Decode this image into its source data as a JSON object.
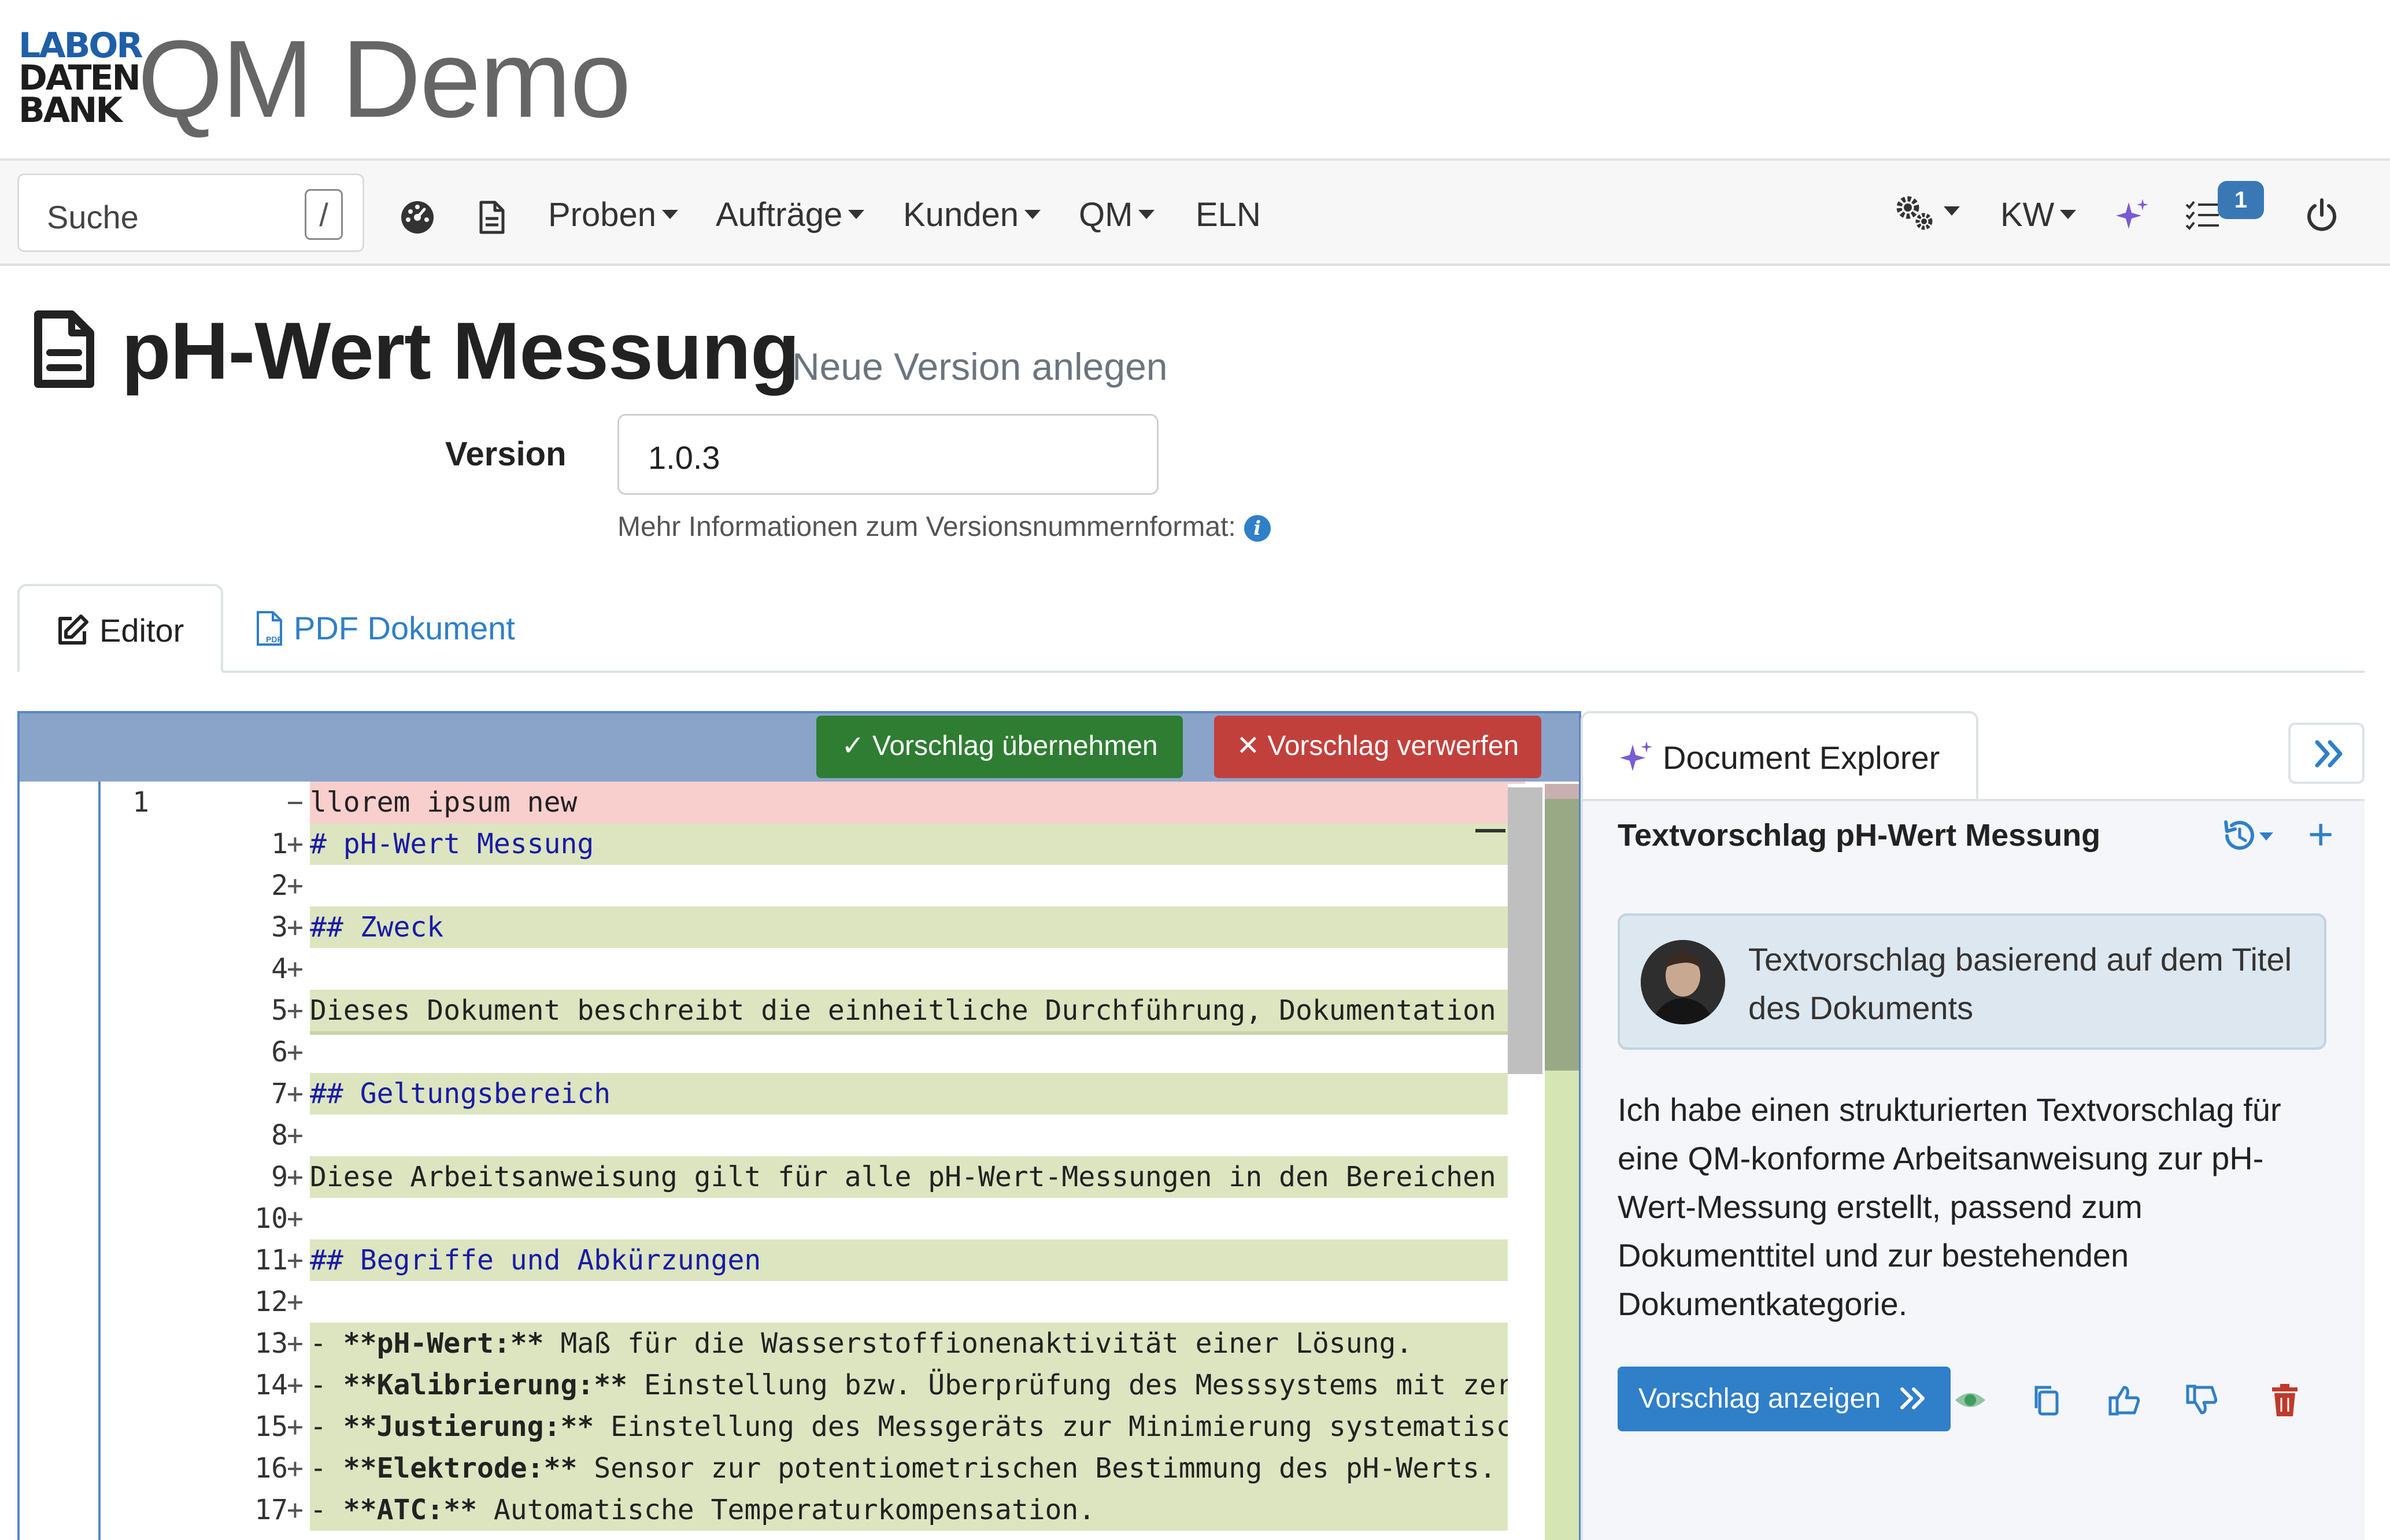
{
  "brand": {
    "logo_lines": [
      "LABOR",
      "DATEN",
      "BANK"
    ],
    "app_title": "QM Demo"
  },
  "navbar": {
    "search_placeholder": "Suche",
    "search_shortcut": "/",
    "menu": [
      {
        "label": "Proben",
        "has_caret": true
      },
      {
        "label": "Aufträge",
        "has_caret": true
      },
      {
        "label": "Kunden",
        "has_caret": true
      },
      {
        "label": "QM",
        "has_caret": true
      },
      {
        "label": "ELN",
        "has_caret": false
      }
    ],
    "user_initials": "KW",
    "tasks_badge": "1",
    "icons": [
      "dashboard-icon",
      "document-icon",
      "settings-gears-icon",
      "ai-sparkle-icon",
      "task-list-icon",
      "power-icon"
    ]
  },
  "page": {
    "title": "pH-Wert Messung",
    "subtitle": "Neue Version anlegen",
    "version_label": "Version",
    "version_value": "1.0.3",
    "version_help": "Mehr Informationen zum Versionsnummernformat:"
  },
  "tabs": [
    {
      "label": "Editor",
      "active": true
    },
    {
      "label": "PDF Dokument",
      "active": false
    }
  ],
  "editor": {
    "accept_label": "✓ Vorschlag übernehmen",
    "reject_label": "✕ Vorschlag verwerfen",
    "lines": [
      {
        "orig": "1",
        "new": "",
        "marker": "−",
        "type": "del",
        "text": "llorem ipsum new"
      },
      {
        "orig": "",
        "new": "1",
        "marker": "+",
        "type": "heading",
        "text": "# pH-Wert Messung"
      },
      {
        "orig": "",
        "new": "2",
        "marker": "+",
        "type": "plain",
        "text": ""
      },
      {
        "orig": "",
        "new": "3",
        "marker": "+",
        "type": "heading",
        "text": "## Zweck"
      },
      {
        "orig": "",
        "new": "4",
        "marker": "+",
        "type": "plain",
        "text": ""
      },
      {
        "orig": "",
        "new": "5",
        "marker": "+",
        "type": "plain",
        "text": "Dieses Dokument beschreibt die einheitliche Durchführung, Dokumentation u"
      },
      {
        "orig": "",
        "new": "6",
        "marker": "+",
        "type": "sep",
        "text": ""
      },
      {
        "orig": "",
        "new": "7",
        "marker": "+",
        "type": "heading",
        "text": "## Geltungsbereich"
      },
      {
        "orig": "",
        "new": "8",
        "marker": "+",
        "type": "plain",
        "text": ""
      },
      {
        "orig": "",
        "new": "9",
        "marker": "+",
        "type": "plain",
        "text": "Diese Arbeitsanweisung gilt für alle pH-Wert-Messungen in den Bereichen C"
      },
      {
        "orig": "",
        "new": "10",
        "marker": "+",
        "type": "plain",
        "text": ""
      },
      {
        "orig": "",
        "new": "11",
        "marker": "+",
        "type": "heading",
        "text": "## Begriffe und Abkürzungen"
      },
      {
        "orig": "",
        "new": "12",
        "marker": "+",
        "type": "plain",
        "text": ""
      },
      {
        "orig": "",
        "new": "13",
        "marker": "+",
        "type": "bullet",
        "term": "pH-Wert:",
        "text": " Maß für die Wasserstoffionenaktivität einer Lösung."
      },
      {
        "orig": "",
        "new": "14",
        "marker": "+",
        "type": "bullet",
        "term": "Kalibrierung:",
        "text": " Einstellung bzw. Überprüfung des Messsystems mit zert"
      },
      {
        "orig": "",
        "new": "15",
        "marker": "+",
        "type": "bullet",
        "term": "Justierung:",
        "text": " Einstellung des Messgeräts zur Minimierung systematisch"
      },
      {
        "orig": "",
        "new": "16",
        "marker": "+",
        "type": "bullet",
        "term": "Elektrode:",
        "text": " Sensor zur potentiometrischen Bestimmung des pH-Werts."
      },
      {
        "orig": "",
        "new": "17",
        "marker": "+",
        "type": "bullet",
        "term": "ATC:",
        "text": " Automatische Temperaturkompensation."
      }
    ]
  },
  "explorer": {
    "tab_label": "Document Explorer",
    "heading": "Textvorschlag pH-Wert Messung",
    "user_message": "Textvorschlag basierend auf dem Titel des Dokuments",
    "assistant_message": "Ich habe einen strukturierten Textvorschlag für eine QM-konforme Arbeitsanweisung zur pH-Wert-Messung erstellt, passend zum Dokumenttitel und zur bestehenden Dokumentkategorie.",
    "show_button": "Vorschlag anzeigen",
    "colors": {
      "accent": "#2f7fc9",
      "accept": "#2e7d32",
      "reject": "#c2403c",
      "sparkle": "#7a5bd6",
      "delete": "#c0392b",
      "seen": "#3f9b5c"
    }
  }
}
